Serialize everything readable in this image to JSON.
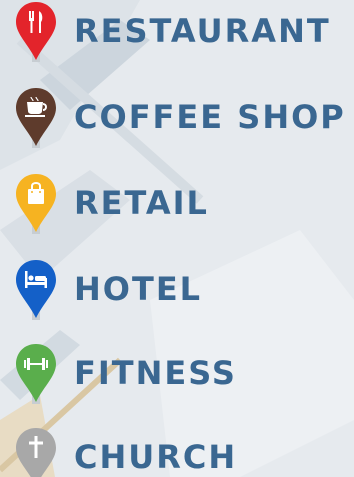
{
  "legend": {
    "items": [
      {
        "label": "RESTAURANT",
        "color": "#e3242b",
        "icon": "fork-knife-icon"
      },
      {
        "label": "COFFEE SHOP",
        "color": "#5e3b2c",
        "icon": "coffee-cup-icon"
      },
      {
        "label": "RETAIL",
        "color": "#f6b321",
        "icon": "shopping-bag-icon"
      },
      {
        "label": "HOTEL",
        "color": "#1460c8",
        "icon": "bed-icon"
      },
      {
        "label": "FITNESS",
        "color": "#5aae4c",
        "icon": "dumbbell-icon"
      },
      {
        "label": "CHURCH",
        "color": "#a8a8a8",
        "icon": "cross-icon"
      }
    ]
  },
  "theme": {
    "label_color": "#3a6791",
    "background": "#e3e8ec"
  }
}
